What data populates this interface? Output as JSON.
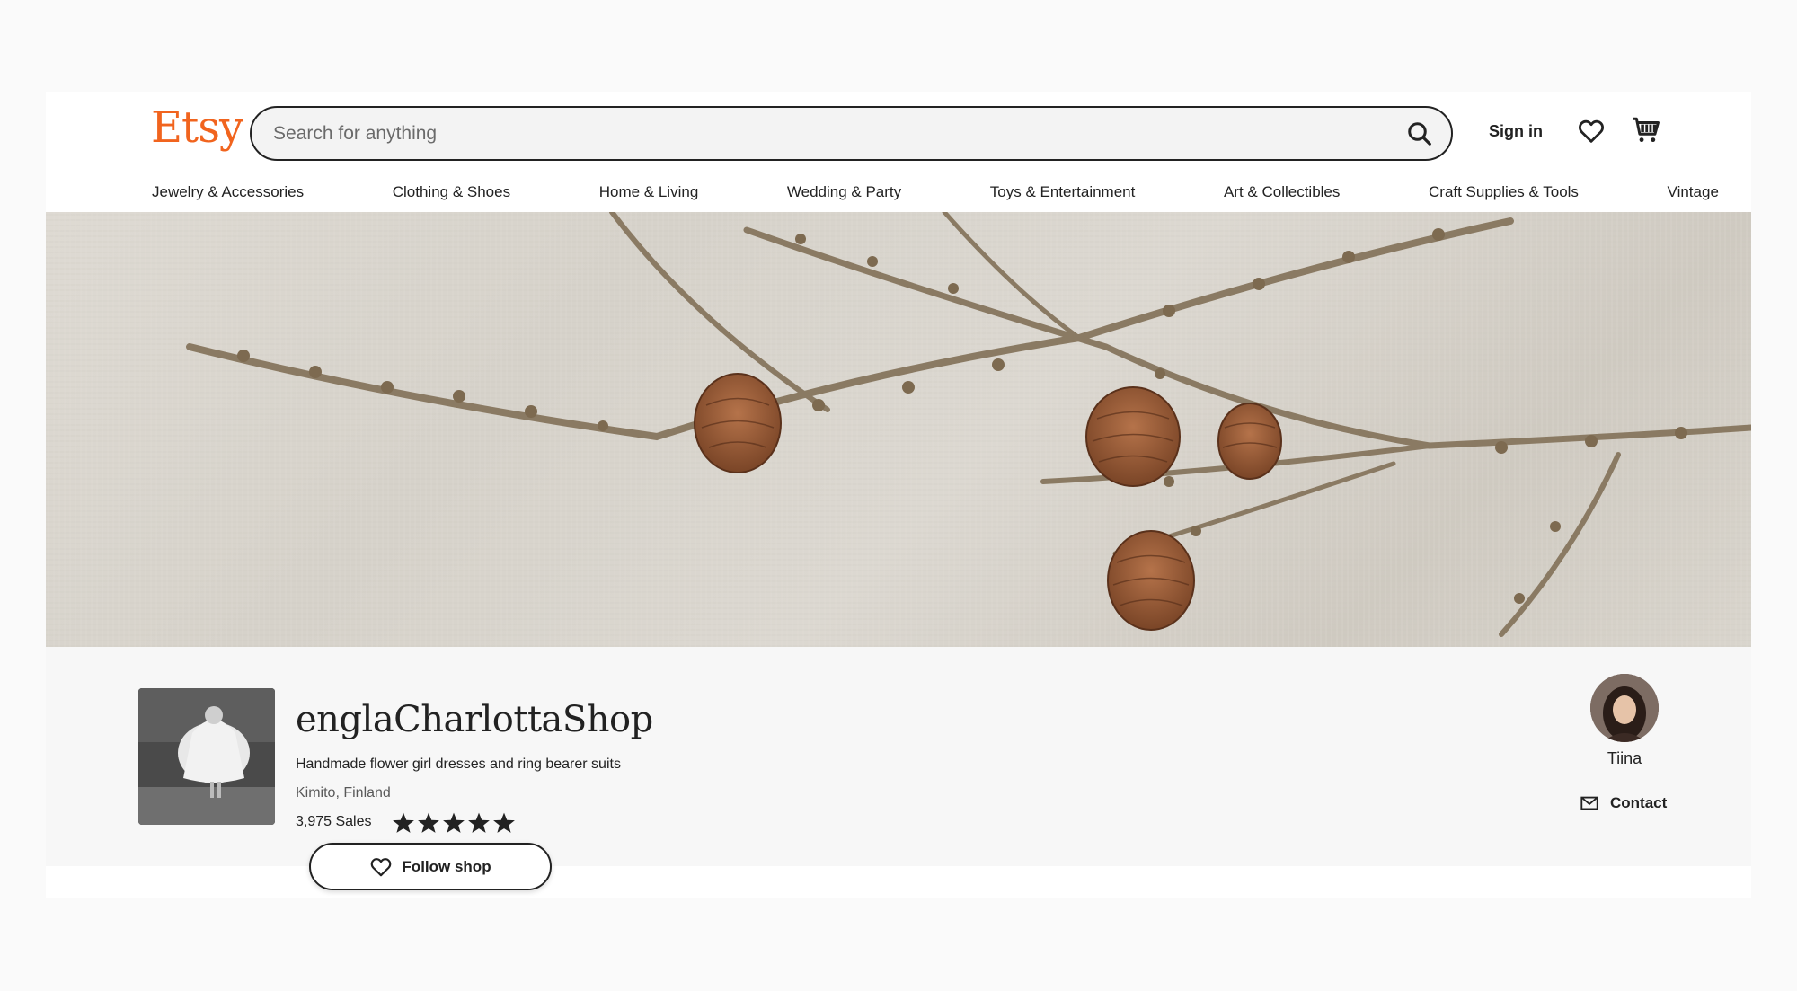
{
  "header": {
    "logo": "Etsy",
    "search_placeholder": "Search for anything",
    "signin_label": "Sign in"
  },
  "categories": [
    "Jewelry & Accessories",
    "Clothing & Shoes",
    "Home & Living",
    "Wedding & Party",
    "Toys & Entertainment",
    "Art & Collectibles",
    "Craft Supplies & Tools",
    "Vintage"
  ],
  "shop": {
    "name": "englaCharlottaShop",
    "tagline": "Handmade flower girl dresses and ring bearer suits",
    "location": "Kimito, Finland",
    "sales": "3,975 Sales",
    "rating": 5,
    "follow_label": "Follow shop"
  },
  "owner": {
    "name": "Tiina",
    "contact_label": "Contact"
  },
  "colors": {
    "brand": "#f1641e",
    "text": "#222222"
  },
  "icons": [
    "search-icon",
    "heart-icon",
    "cart-icon",
    "star-icon",
    "mail-icon"
  ]
}
